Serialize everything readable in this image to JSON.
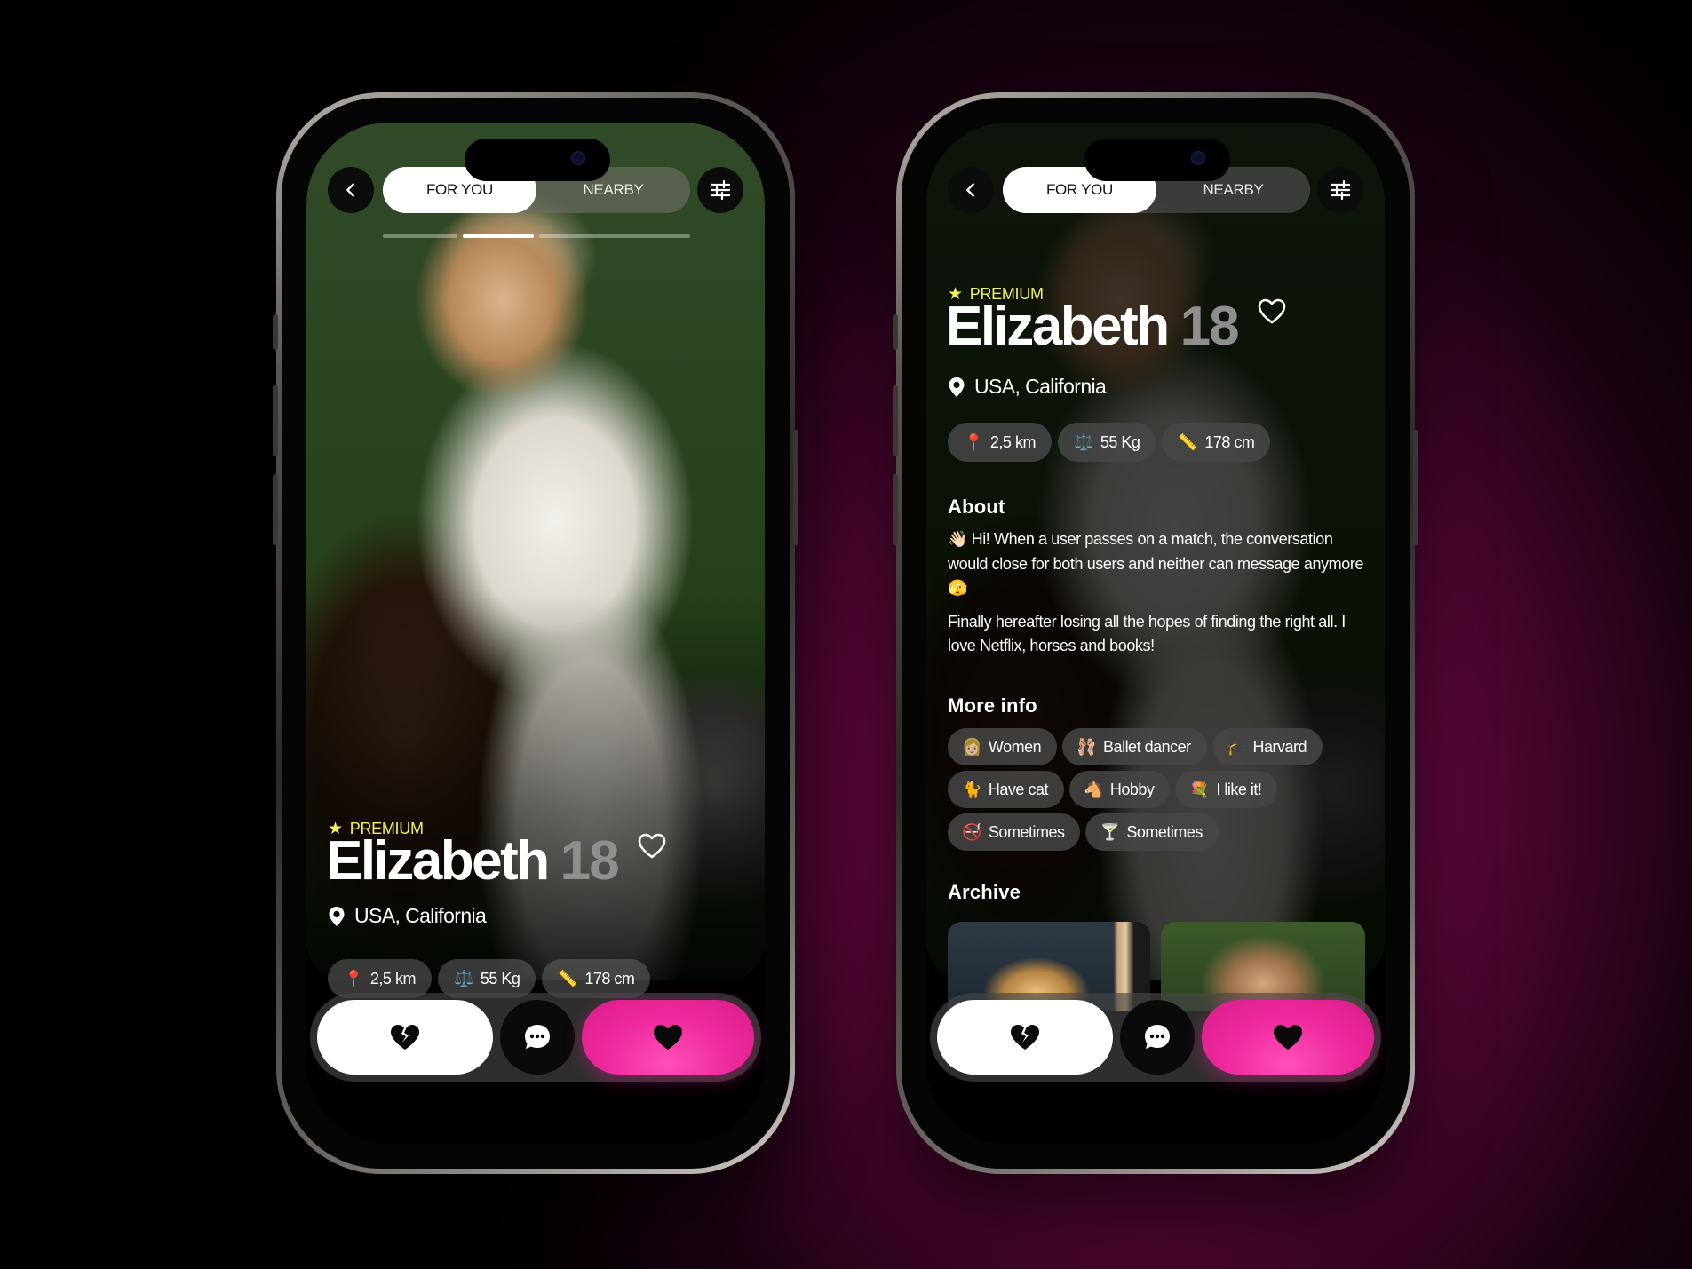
{
  "left_screen": {
    "tabs": [
      {
        "label": "FOR YOU"
      },
      {
        "label": "NEARBY"
      }
    ],
    "premium_label": "PREMIUM",
    "name": "Elizabeth",
    "age": "18",
    "location": "USA, California",
    "stats": [
      {
        "emoji": "📍",
        "label": "2,5 km"
      },
      {
        "emoji": "⚖️",
        "label": "55 Kg"
      },
      {
        "emoji": "📏",
        "label": "178 cm"
      }
    ]
  },
  "right_screen": {
    "tabs": [
      {
        "label": "FOR YOU"
      },
      {
        "label": "NEARBY"
      }
    ],
    "premium_label": "PREMIUM",
    "name": "Elizabeth",
    "age": "18",
    "location": "USA, California",
    "stats": [
      {
        "emoji": "📍",
        "label": "2,5 km"
      },
      {
        "emoji": "⚖️",
        "label": "55 Kg"
      },
      {
        "emoji": "📏",
        "label": "178 cm"
      }
    ],
    "about": {
      "title": "About",
      "paragraph_1": "👋🏻 Hi! When a user passes on a match, the conversation would close for both users and neither can message anymore 🫣",
      "paragraph_2": "Finally hereafter losing all the hopes of finding the right all. I love Netflix, horses and books!"
    },
    "more_info": {
      "title": "More info",
      "tags": [
        {
          "emoji": "👩🏼",
          "label": "Women"
        },
        {
          "emoji": "🩰",
          "label": "Ballet dancer"
        },
        {
          "emoji": "🎓",
          "label": "Harvard"
        },
        {
          "emoji": "🐈",
          "label": "Have cat"
        },
        {
          "emoji": "🐴",
          "label": "Hobby"
        },
        {
          "emoji": "💐",
          "label": "I like it!"
        },
        {
          "emoji": "🚭",
          "label": "Sometimes"
        },
        {
          "emoji": "🍸",
          "label": "Sometimes"
        }
      ]
    },
    "archive": {
      "title": "Archive"
    }
  },
  "icons": {
    "back": "chevron-left-icon",
    "filter": "sliders-icon",
    "favorite": "heart-outline-icon",
    "location": "map-pin-icon",
    "dislike": "broken-heart-icon",
    "chat": "chat-bubble-icon",
    "like": "heart-icon"
  },
  "colors": {
    "accent_pink": "#ef2a9e",
    "premium_yellow": "#f3f05a",
    "background_magenta": "#8b0b56"
  }
}
